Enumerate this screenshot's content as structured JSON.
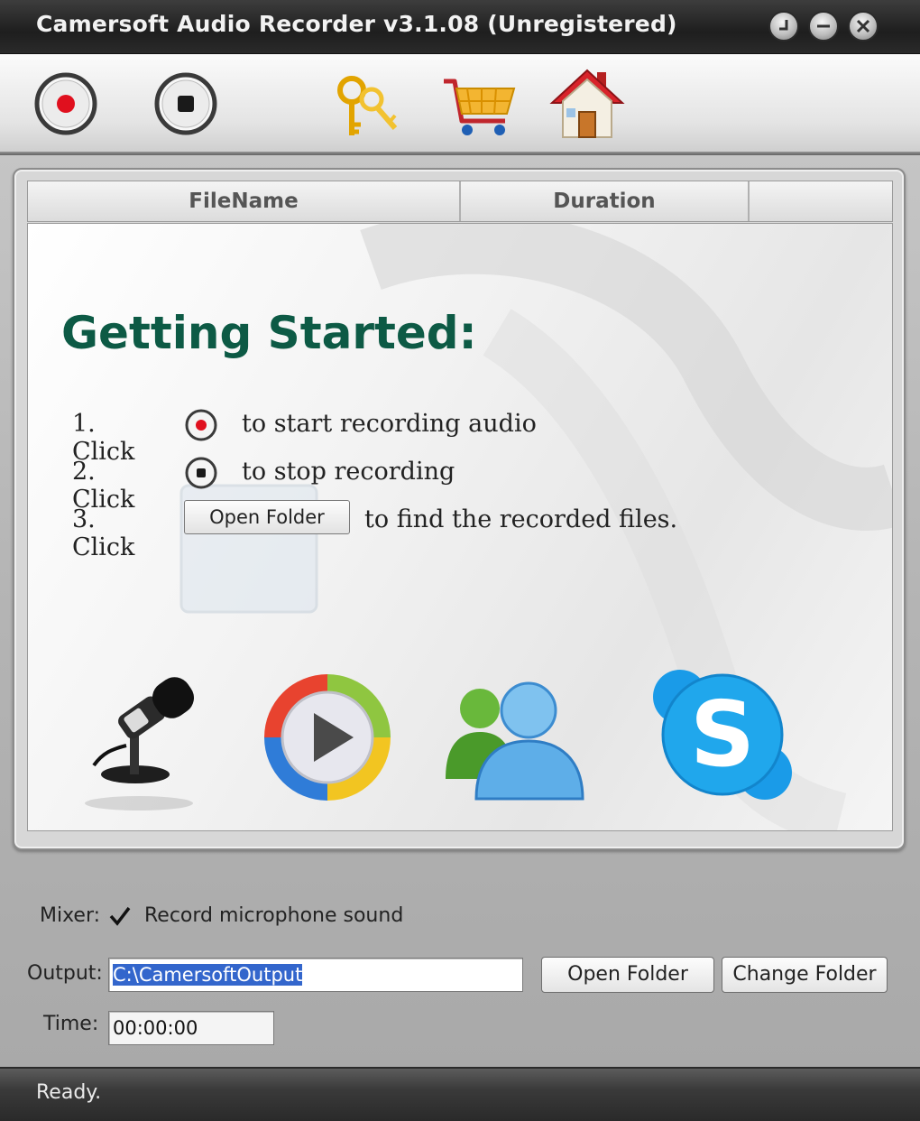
{
  "window": {
    "title": "Camersoft Audio Recorder v3.1.08 (Unregistered)"
  },
  "toolbar": {
    "items": [
      {
        "name": "record",
        "icon": "record-icon"
      },
      {
        "name": "stop",
        "icon": "stop-icon"
      },
      {
        "name": "register",
        "icon": "keys-icon"
      },
      {
        "name": "buy",
        "icon": "shopping-cart-icon"
      },
      {
        "name": "home",
        "icon": "home-icon"
      }
    ]
  },
  "list": {
    "columns": [
      "FileName",
      "Duration"
    ]
  },
  "guide": {
    "heading": "Getting Started:",
    "steps": [
      {
        "number": "1. Click",
        "text": "to start recording audio",
        "icon": "record-icon"
      },
      {
        "number": "2. Click",
        "text": "to stop recording",
        "icon": "stop-icon"
      },
      {
        "number": "3. Click",
        "text": "to find the recorded files.",
        "button_label": "Open Folder"
      }
    ],
    "source_icons": [
      "microphone-icon",
      "media-player-icon",
      "messenger-icon",
      "skype-icon"
    ]
  },
  "controls": {
    "mixer_label": "Mixer:",
    "mixer_checkbox_label": "Record microphone sound",
    "mixer_checked": true,
    "output_label": "Output:",
    "output_value": "C:\\CamersoftOutput",
    "open_folder_label": "Open Folder",
    "change_folder_label": "Change Folder",
    "time_label": "Time:",
    "time_value": "00:00:00"
  },
  "status": {
    "text": "Ready."
  },
  "colors": {
    "heading": "#0d5a45",
    "record_red": "#e0101e",
    "selection": "#3366cc"
  }
}
